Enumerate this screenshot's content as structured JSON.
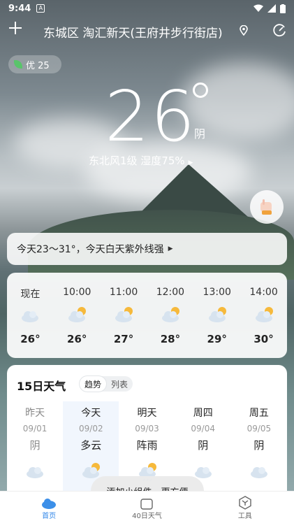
{
  "status_bar": {
    "time": "9:44"
  },
  "header": {
    "location": "东城区 淘汇新天(王府井步行街店)"
  },
  "aqi": {
    "label": "优 25"
  },
  "current": {
    "temperature": "26",
    "condition": "阴",
    "details": "东北风1级  湿度75%"
  },
  "tip": {
    "text": "今天23～31°，今天白天紫外线强"
  },
  "hourly": [
    {
      "time": "现在",
      "icon": "cloudy-icon",
      "temp": "26°"
    },
    {
      "time": "10:00",
      "icon": "partly-cloudy-icon",
      "temp": "26°"
    },
    {
      "time": "11:00",
      "icon": "partly-cloudy-icon",
      "temp": "27°"
    },
    {
      "time": "12:00",
      "icon": "partly-cloudy-icon",
      "temp": "28°"
    },
    {
      "time": "13:00",
      "icon": "partly-cloudy-icon",
      "temp": "29°"
    },
    {
      "time": "14:00",
      "icon": "partly-cloudy-icon",
      "temp": "30°"
    }
  ],
  "forecast": {
    "title": "15日天气",
    "toggle": [
      "趋势",
      "列表"
    ],
    "days": [
      {
        "name": "昨天",
        "date": "09/01",
        "weather": "阴",
        "icon": "cloudy-icon"
      },
      {
        "name": "今天",
        "date": "09/02",
        "weather": "多云",
        "icon": "partly-cloudy-icon"
      },
      {
        "name": "明天",
        "date": "09/03",
        "weather": "阵雨",
        "icon": "shower-icon"
      },
      {
        "name": "周四",
        "date": "09/04",
        "weather": "阴",
        "icon": "cloudy-icon"
      },
      {
        "name": "周五",
        "date": "09/05",
        "weather": "阴",
        "icon": "cloudy-icon"
      }
    ]
  },
  "toast": "添加小组件，更方便",
  "tabs": [
    {
      "label": "首页",
      "icon": "home-cloud-icon"
    },
    {
      "label": "40日天气",
      "icon": "calendar-icon"
    },
    {
      "label": "工具",
      "icon": "tools-icon"
    }
  ],
  "colors": {
    "accent": "#2f86e8"
  }
}
